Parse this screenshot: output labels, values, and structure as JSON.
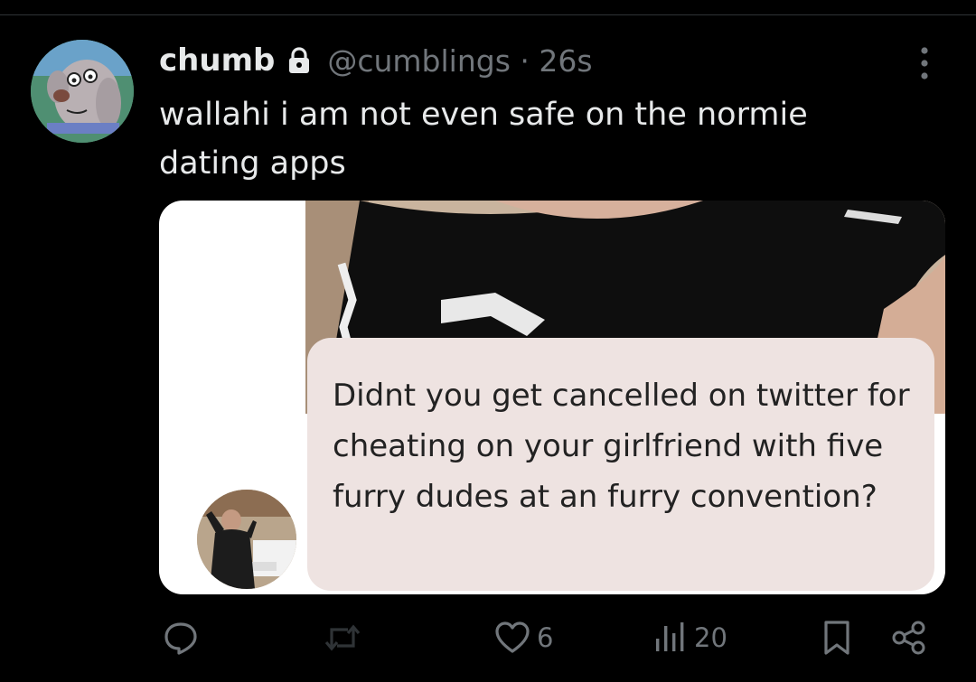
{
  "tweet": {
    "display_name": "chumb",
    "handle_meta": "@cumblings · 26s",
    "text": "wallahi i am not even safe on the normie dating apps",
    "lock_icon": "lock-icon",
    "avatar": "cartoon-dog-avatar"
  },
  "media": {
    "message_text": "Didnt you get cancelled on twitter for cheating on your girlfriend with five furry dudes at an furry convention?",
    "sender_avatar": "profile-photo-avatar"
  },
  "actions": {
    "reply_icon": "reply-icon",
    "retweet_icon": "retweet-icon",
    "like_icon": "heart-icon",
    "like_count": "6",
    "views_icon": "views-bar-chart-icon",
    "views_count": "20",
    "bookmark_icon": "bookmark-icon",
    "share_icon": "share-icon"
  },
  "colors": {
    "background": "#000000",
    "text": "#e7e9ea",
    "muted": "#71767b",
    "bubble": "#eee3e1"
  }
}
